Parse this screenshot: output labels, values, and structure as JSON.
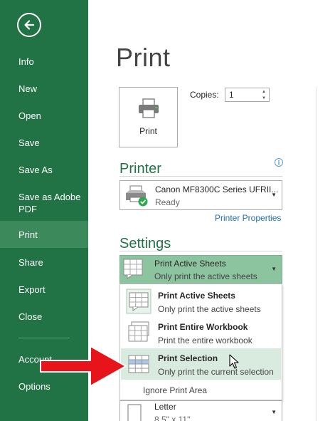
{
  "sidebar": {
    "back_icon": "back-arrow-icon",
    "items": [
      {
        "label": "Info"
      },
      {
        "label": "New"
      },
      {
        "label": "Open"
      },
      {
        "label": "Save"
      },
      {
        "label": "Save As"
      },
      {
        "label": "Save as Adobe PDF"
      },
      {
        "label": "Print",
        "selected": true
      },
      {
        "label": "Share"
      },
      {
        "label": "Export"
      },
      {
        "label": "Close"
      },
      {
        "label": "Account"
      },
      {
        "label": "Options"
      }
    ]
  },
  "main": {
    "title": "Print",
    "print_button": {
      "label": "Print",
      "icon": "printer-icon"
    },
    "copies": {
      "label": "Copies:",
      "value": "1"
    },
    "printer": {
      "heading": "Printer",
      "name": "Canon MF8300C Series UFRII...",
      "status": "Ready",
      "properties_link": "Printer Properties"
    },
    "settings": {
      "heading": "Settings",
      "selected": {
        "title": "Print Active Sheets",
        "subtitle": "Only print the active sheets"
      },
      "menu": [
        {
          "title": "Print Active Sheets",
          "subtitle": "Only print the active sheets"
        },
        {
          "title": "Print Entire Workbook",
          "subtitle": "Print the entire workbook"
        },
        {
          "title": "Print Selection",
          "subtitle": "Only print the current selection",
          "hovered": true
        }
      ],
      "ignore_print_area": "Ignore Print Area"
    },
    "paper": {
      "title": "Letter",
      "subtitle": "8.5\" x 11\""
    }
  },
  "colors": {
    "sidebar_bg": "#217346",
    "sidebar_selected": "#3c8a5c",
    "accent_green": "#217346",
    "dropdown_selected_bg": "#8dc4a0",
    "menu_hover_bg": "#d9eadf",
    "link_blue": "#1f6fb2",
    "annotation_red": "#e8141b"
  }
}
